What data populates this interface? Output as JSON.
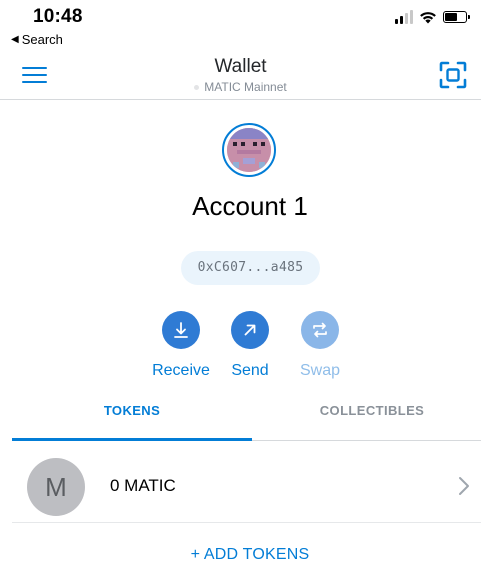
{
  "status_bar": {
    "time": "10:48",
    "back_label": "Search",
    "back_icon": "back-triangle-icon"
  },
  "header": {
    "title": "Wallet",
    "network": "MATIC Mainnet",
    "menu_icon": "hamburger-menu-icon",
    "scan_icon": "qr-scan-icon"
  },
  "account": {
    "name": "Account 1",
    "address": "0xC607...a485",
    "avatar_icon": "identicon-avatar"
  },
  "actions": {
    "receive": {
      "label": "Receive",
      "icon": "download-arrow-icon"
    },
    "send": {
      "label": "Send",
      "icon": "arrow-up-right-icon"
    },
    "swap": {
      "label": "Swap",
      "icon": "swap-arrows-icon",
      "disabled": true
    }
  },
  "tabs": {
    "tokens": "TOKENS",
    "collectibles": "COLLECTIBLES",
    "active": "tokens"
  },
  "tokens": [
    {
      "symbol_letter": "M",
      "balance": "0 MATIC"
    }
  ],
  "add_tokens": "+ ADD TOKENS",
  "colors": {
    "accent": "#037dd6",
    "action_button": "#2f7bd4",
    "disabled_action": "#8ab6e8",
    "address_pill_bg": "#eaf4fc"
  }
}
